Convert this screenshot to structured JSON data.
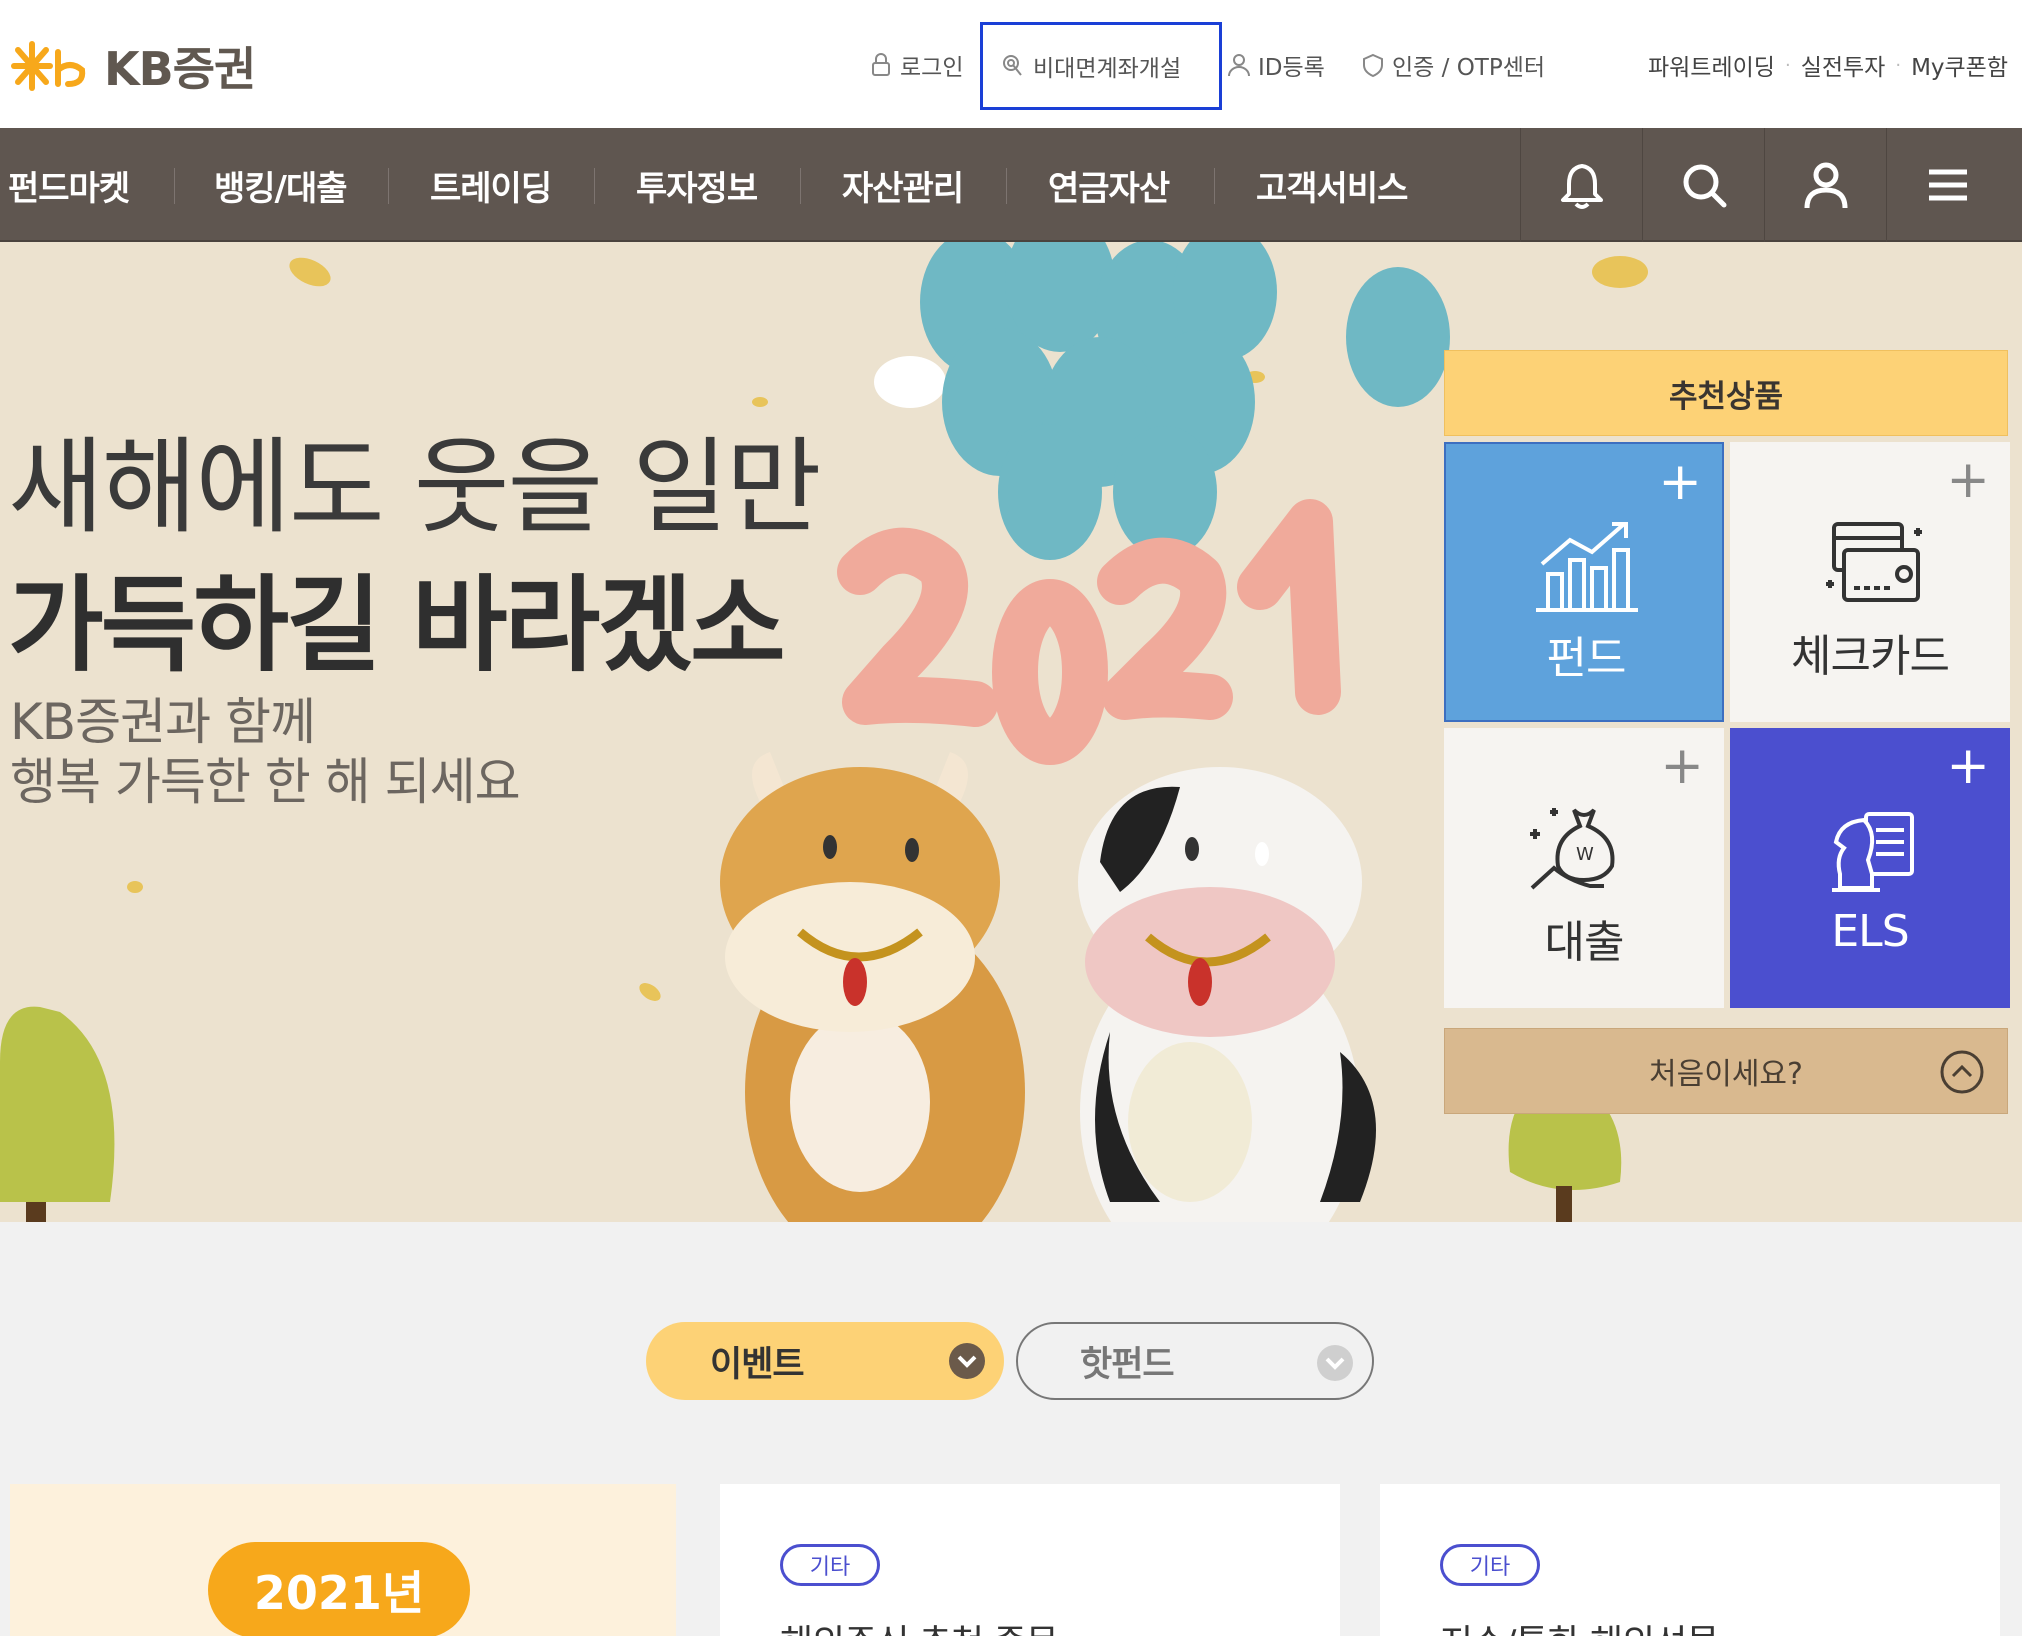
{
  "brand": {
    "name": "KB증권",
    "accent": "#f7a81b",
    "nav_bg": "#5f5650"
  },
  "utility": {
    "login": "로그인",
    "open_account": "비대면계좌개설",
    "id_register": "ID등록",
    "cert_otp": "인증 / OTP센터",
    "right_links": [
      "파워트레이딩",
      "실전투자",
      "My쿠폰함"
    ]
  },
  "nav": {
    "items": [
      "펀드마켓",
      "뱅킹/대출",
      "트레이딩",
      "투자정보",
      "자산관리",
      "연금자산",
      "고객서비스"
    ],
    "icons": [
      "bell-icon",
      "search-icon",
      "user-icon",
      "menu-icon"
    ]
  },
  "banner": {
    "headline_line1": "새해에도 웃을 일만",
    "headline_line2": "가득하길 바라겠소",
    "sub_line1": "KB증권과 함께",
    "sub_line2": "행복 가득한 한 해 되세요",
    "year_art": "2021"
  },
  "recommend": {
    "title": "추천상품",
    "tiles": [
      {
        "label": "펀드",
        "color": "#5ea2dc"
      },
      {
        "label": "체크카드",
        "color": "#f6f4f1"
      },
      {
        "label": "대출",
        "color": "#f6f4f1"
      },
      {
        "label": "ELS",
        "color": "#4b4fcf"
      }
    ],
    "first_time": "처음이세요?"
  },
  "tabs": [
    {
      "label": "이벤트",
      "active": true
    },
    {
      "label": "핫펀드",
      "active": false
    }
  ],
  "cards": [
    {
      "badge": "2021년"
    },
    {
      "category": "기타",
      "title": "해외주식 추천 종목"
    },
    {
      "category": "기타",
      "title": "지수/통화 해외선물"
    }
  ]
}
